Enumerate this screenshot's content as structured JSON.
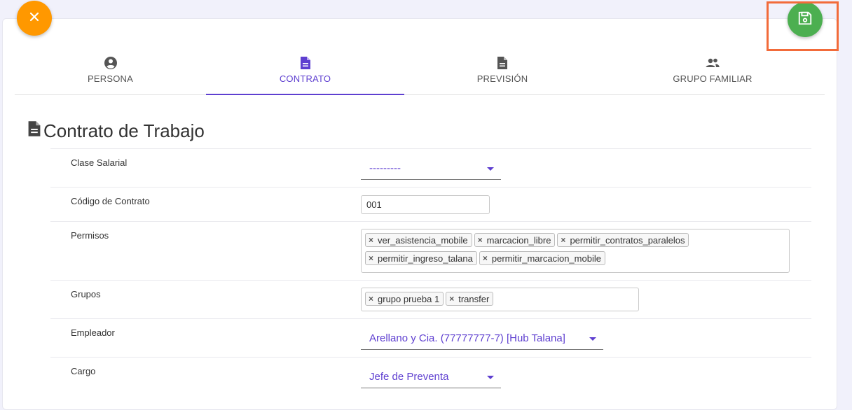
{
  "colors": {
    "accent": "#5e3fd0",
    "close_fab": "#ff9800",
    "save_fab": "#4caf50",
    "highlight": "#f26b3a"
  },
  "fabs": {
    "close_icon": "close-icon",
    "save_icon": "floppy-disk-icon"
  },
  "tabs": [
    {
      "label": "PERSONA",
      "icon": "account-circle-icon",
      "active": false
    },
    {
      "label": "CONTRATO",
      "icon": "document-icon",
      "active": true
    },
    {
      "label": "PREVISIÓN",
      "icon": "document-icon",
      "active": false
    },
    {
      "label": "GRUPO FAMILIAR",
      "icon": "people-icon",
      "active": false
    }
  ],
  "section": {
    "title": "Contrato de Trabajo",
    "icon": "document-icon"
  },
  "form": {
    "clase_salarial": {
      "label": "Clase Salarial",
      "value": "---------"
    },
    "codigo_contrato": {
      "label": "Código de Contrato",
      "value": "001"
    },
    "permisos": {
      "label": "Permisos",
      "tags": [
        "ver_asistencia_mobile",
        "marcacion_libre",
        "permitir_contratos_paralelos",
        "permitir_ingreso_talana",
        "permitir_marcacion_mobile"
      ]
    },
    "grupos": {
      "label": "Grupos",
      "tags": [
        "grupo prueba 1",
        "transfer"
      ]
    },
    "empleador": {
      "label": "Empleador",
      "value": "Arellano y Cia. (77777777-7) [Hub Talana]"
    },
    "cargo": {
      "label": "Cargo",
      "value": "Jefe de Preventa"
    }
  }
}
